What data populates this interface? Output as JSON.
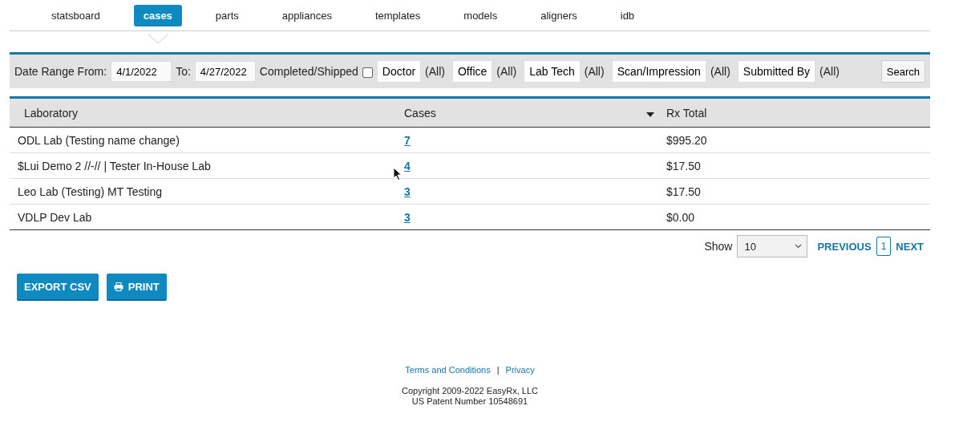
{
  "nav": [
    {
      "label": "statsboard",
      "selected": false
    },
    {
      "label": "cases",
      "selected": true
    },
    {
      "label": "parts",
      "selected": false
    },
    {
      "label": "appliances",
      "selected": false
    },
    {
      "label": "templates",
      "selected": false
    },
    {
      "label": "models",
      "selected": false
    },
    {
      "label": "aligners",
      "selected": false
    },
    {
      "label": "idb",
      "selected": false
    }
  ],
  "filters": {
    "from_label": "Date Range From:",
    "from": "4/1/2022",
    "to_label": "To:",
    "to": "4/27/2022",
    "completed_label": "Completed/Shipped",
    "completed_checked": false,
    "pickers": [
      {
        "label": "Doctor",
        "value": "(All)"
      },
      {
        "label": "Office",
        "value": "(All)"
      },
      {
        "label": "Lab Tech",
        "value": "(All)"
      },
      {
        "label": "Scan/Impression",
        "value": "(All)"
      },
      {
        "label": "Submitted By",
        "value": "(All)"
      }
    ],
    "search": "Search"
  },
  "table": {
    "columns": [
      "Laboratory",
      "Cases",
      "Rx Total"
    ],
    "rows": [
      {
        "laboratory": "ODL Lab (Testing name change)",
        "cases": "7",
        "rx_total": "$995.20"
      },
      {
        "laboratory": "$Lui Demo 2 //-// | Tester In-House Lab",
        "cases": "4",
        "rx_total": "$17.50"
      },
      {
        "laboratory": "Leo Lab (Testing) MT Testing",
        "cases": "3",
        "rx_total": "$17.50"
      },
      {
        "laboratory": "VDLP Dev Lab",
        "cases": "3",
        "rx_total": "$0.00"
      }
    ]
  },
  "pager": {
    "show_label": "Show",
    "page_size": "10",
    "previous": "PREVIOUS",
    "pages": [
      {
        "label": "1",
        "selected": true
      }
    ],
    "next": "NEXT"
  },
  "actions": {
    "export": "EXPORT CSV",
    "print": "PRINT"
  },
  "footer": {
    "links": [
      "Terms and Conditions",
      "Privacy"
    ],
    "separator": "|",
    "copyright": "Copyright 2009-2022 EasyRx, LLC",
    "patent": "US Patent Number 10548691"
  }
}
